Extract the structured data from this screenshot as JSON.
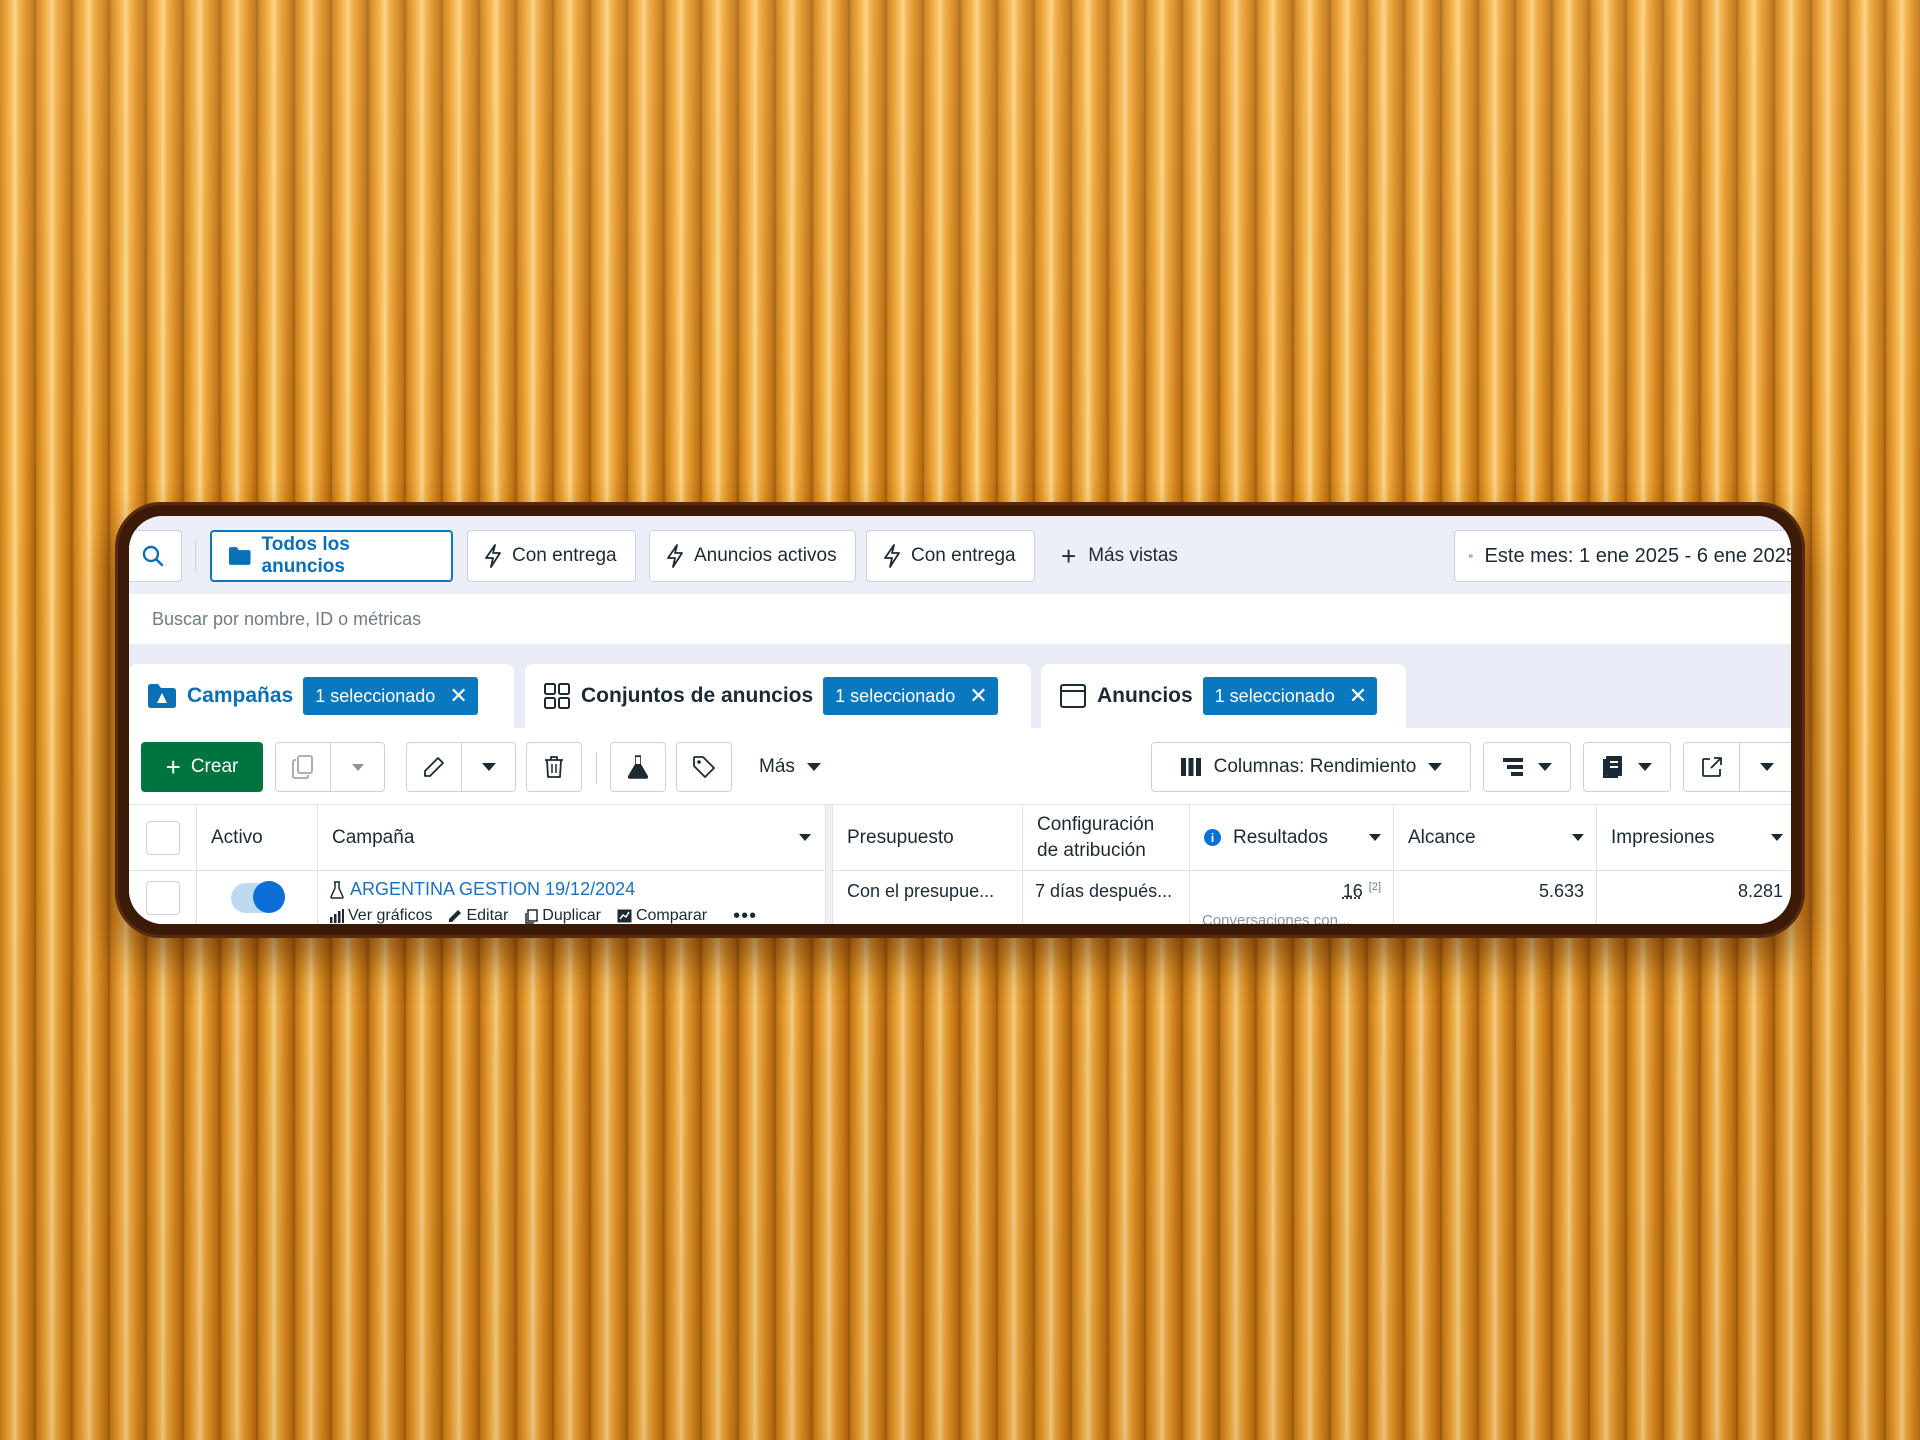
{
  "topbar": {
    "views": [
      {
        "label": "Todos los anuncios"
      },
      {
        "label": "Con entrega"
      },
      {
        "label": "Anuncios activos"
      },
      {
        "label": "Con entrega"
      }
    ],
    "more_views": "Más vistas",
    "date_range": "Este mes: 1 ene 2025 - 6 ene 2025"
  },
  "search": {
    "placeholder": "Buscar por nombre, ID o métricas"
  },
  "levels": [
    {
      "label": "Campañas",
      "badge": "1 seleccionado"
    },
    {
      "label": "Conjuntos de anuncios",
      "badge": "1 seleccionado"
    },
    {
      "label": "Anuncios",
      "badge": "1 seleccionado"
    }
  ],
  "toolbar": {
    "create": "Crear",
    "more": "Más",
    "columns": "Columnas: Rendimiento"
  },
  "table": {
    "headers": {
      "active": "Activo",
      "campaign": "Campaña",
      "budget": "Presupuesto",
      "attribution_1": "Configuración",
      "attribution_2": "de atribución",
      "results": "Resultados",
      "reach": "Alcance",
      "impressions": "Impresiones"
    },
    "rows": [
      {
        "campaign": "ARGENTINA GESTION 19/12/2024",
        "active": true,
        "actions": [
          "Ver gráficos",
          "Editar",
          "Duplicar",
          "Comparar"
        ],
        "budget": "Con el presupue...",
        "attribution": "7 días después...",
        "results": "16",
        "results_note": "[2]",
        "results_type": "Conversaciones con...",
        "reach": "5.633",
        "impressions": "8.281"
      }
    ]
  },
  "colors": {
    "primary": "#0a78be",
    "create": "#00743f",
    "link": "#1d6fc2"
  }
}
